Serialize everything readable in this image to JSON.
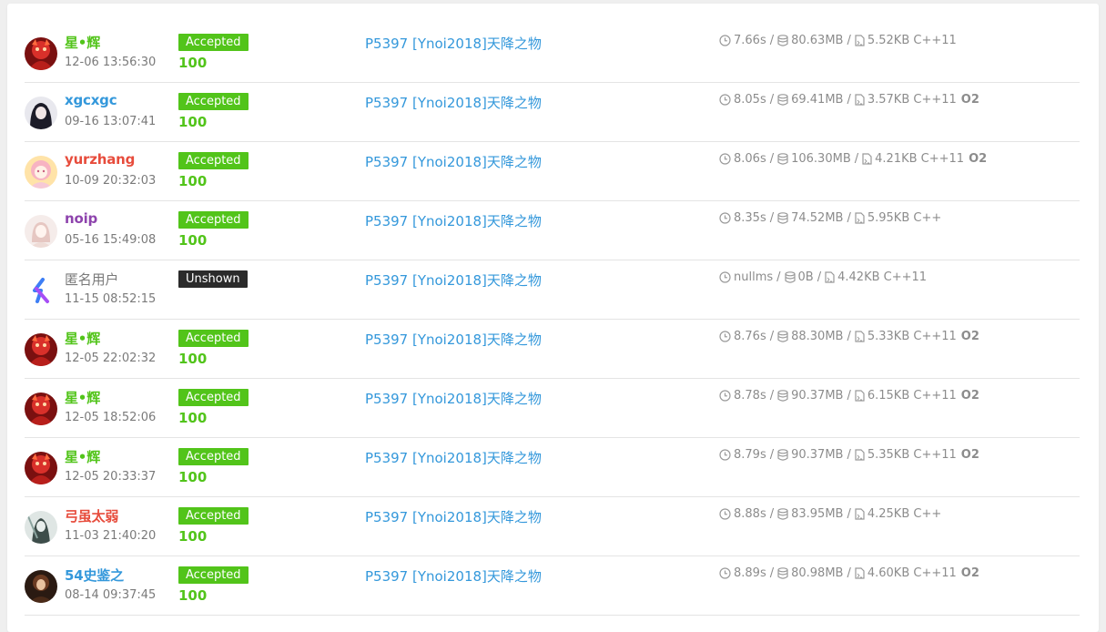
{
  "colors": {
    "accepted": "#52c41a",
    "unshown": "#2b2b2b",
    "problem_link": "#3498db",
    "name_green": "#52c41a",
    "name_blue": "#3498db",
    "name_red": "#e74c3c",
    "name_purple": "#8e44ad",
    "name_gray": "#7a7a7a"
  },
  "records": [
    {
      "user": "星•辉",
      "name_color": "#52c41a",
      "avatar": "avatar-red",
      "time": "12-06 13:56:30",
      "status": "Accepted",
      "score": "100",
      "problem": "P5397 [Ynoi2018]天降之物",
      "run_time": "7.66s",
      "memory": "80.63MB",
      "code_size": "5.52KB",
      "language": "C++11",
      "o2": ""
    },
    {
      "user": "xgcxgc",
      "name_color": "#3498db",
      "avatar": "avatar-dark",
      "time": "09-16 13:07:41",
      "status": "Accepted",
      "score": "100",
      "problem": "P5397 [Ynoi2018]天降之物",
      "run_time": "8.05s",
      "memory": "69.41MB",
      "code_size": "3.57KB",
      "language": "C++11",
      "o2": "O2"
    },
    {
      "user": "yurzhang",
      "name_color": "#e74c3c",
      "avatar": "avatar-pink",
      "time": "10-09 20:32:03",
      "status": "Accepted",
      "score": "100",
      "problem": "P5397 [Ynoi2018]天降之物",
      "run_time": "8.06s",
      "memory": "106.30MB",
      "code_size": "4.21KB",
      "language": "C++11",
      "o2": "O2"
    },
    {
      "user": "noip",
      "name_color": "#8e44ad",
      "avatar": "avatar-light",
      "time": "05-16 15:49:08",
      "status": "Accepted",
      "score": "100",
      "problem": "P5397 [Ynoi2018]天降之物",
      "run_time": "8.35s",
      "memory": "74.52MB",
      "code_size": "5.95KB",
      "language": "C++",
      "o2": ""
    },
    {
      "user": "匿名用户",
      "name_color": "#7a7a7a",
      "avatar": "avatar-logo",
      "time": "11-15 08:52:15",
      "status": "Unshown",
      "score": "",
      "problem": "P5397 [Ynoi2018]天降之物",
      "run_time": "nullms",
      "memory": "0B",
      "code_size": "4.42KB",
      "language": "C++11",
      "o2": ""
    },
    {
      "user": "星•辉",
      "name_color": "#52c41a",
      "avatar": "avatar-red",
      "time": "12-05 22:02:32",
      "status": "Accepted",
      "score": "100",
      "problem": "P5397 [Ynoi2018]天降之物",
      "run_time": "8.76s",
      "memory": "88.30MB",
      "code_size": "5.33KB",
      "language": "C++11",
      "o2": "O2"
    },
    {
      "user": "星•辉",
      "name_color": "#52c41a",
      "avatar": "avatar-red",
      "time": "12-05 18:52:06",
      "status": "Accepted",
      "score": "100",
      "problem": "P5397 [Ynoi2018]天降之物",
      "run_time": "8.78s",
      "memory": "90.37MB",
      "code_size": "6.15KB",
      "language": "C++11",
      "o2": "O2"
    },
    {
      "user": "星•辉",
      "name_color": "#52c41a",
      "avatar": "avatar-red",
      "time": "12-05 20:33:37",
      "status": "Accepted",
      "score": "100",
      "problem": "P5397 [Ynoi2018]天降之物",
      "run_time": "8.79s",
      "memory": "90.37MB",
      "code_size": "5.35KB",
      "language": "C++11",
      "o2": "O2"
    },
    {
      "user": "弓虽太弱",
      "name_color": "#e74c3c",
      "avatar": "avatar-teal",
      "time": "11-03 21:40:20",
      "status": "Accepted",
      "score": "100",
      "problem": "P5397 [Ynoi2018]天降之物",
      "run_time": "8.88s",
      "memory": "83.95MB",
      "code_size": "4.25KB",
      "language": "C++",
      "o2": ""
    },
    {
      "user": "54史鉴之",
      "name_color": "#3498db",
      "avatar": "avatar-brown",
      "time": "08-14 09:37:45",
      "status": "Accepted",
      "score": "100",
      "problem": "P5397 [Ynoi2018]天降之物",
      "run_time": "8.89s",
      "memory": "80.98MB",
      "code_size": "4.60KB",
      "language": "C++11",
      "o2": "O2"
    }
  ]
}
